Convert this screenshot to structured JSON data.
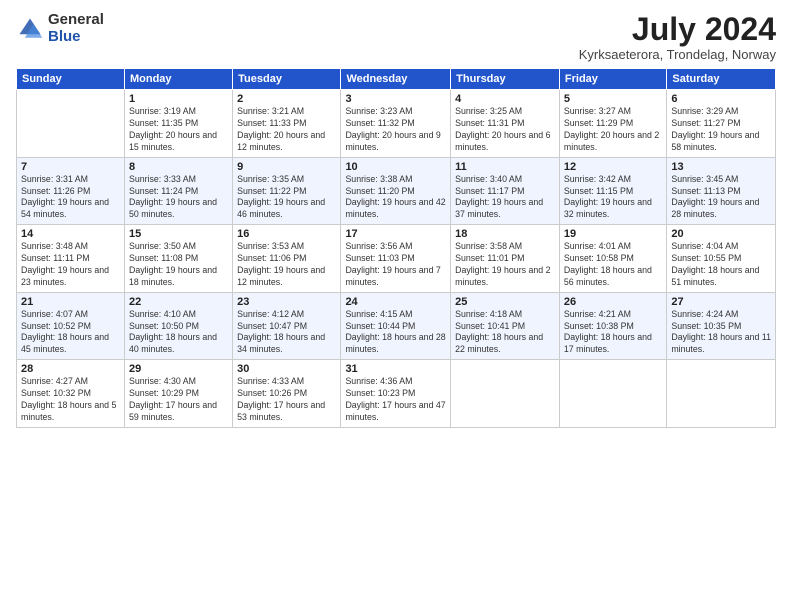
{
  "logo": {
    "general": "General",
    "blue": "Blue"
  },
  "title": "July 2024",
  "location": "Kyrksaeterora, Trondelag, Norway",
  "weekdays": [
    "Sunday",
    "Monday",
    "Tuesday",
    "Wednesday",
    "Thursday",
    "Friday",
    "Saturday"
  ],
  "weeks": [
    [
      {
        "day": "",
        "sunrise": "",
        "sunset": "",
        "daylight": ""
      },
      {
        "day": "1",
        "sunrise": "Sunrise: 3:19 AM",
        "sunset": "Sunset: 11:35 PM",
        "daylight": "Daylight: 20 hours and 15 minutes."
      },
      {
        "day": "2",
        "sunrise": "Sunrise: 3:21 AM",
        "sunset": "Sunset: 11:33 PM",
        "daylight": "Daylight: 20 hours and 12 minutes."
      },
      {
        "day": "3",
        "sunrise": "Sunrise: 3:23 AM",
        "sunset": "Sunset: 11:32 PM",
        "daylight": "Daylight: 20 hours and 9 minutes."
      },
      {
        "day": "4",
        "sunrise": "Sunrise: 3:25 AM",
        "sunset": "Sunset: 11:31 PM",
        "daylight": "Daylight: 20 hours and 6 minutes."
      },
      {
        "day": "5",
        "sunrise": "Sunrise: 3:27 AM",
        "sunset": "Sunset: 11:29 PM",
        "daylight": "Daylight: 20 hours and 2 minutes."
      },
      {
        "day": "6",
        "sunrise": "Sunrise: 3:29 AM",
        "sunset": "Sunset: 11:27 PM",
        "daylight": "Daylight: 19 hours and 58 minutes."
      }
    ],
    [
      {
        "day": "7",
        "sunrise": "Sunrise: 3:31 AM",
        "sunset": "Sunset: 11:26 PM",
        "daylight": "Daylight: 19 hours and 54 minutes."
      },
      {
        "day": "8",
        "sunrise": "Sunrise: 3:33 AM",
        "sunset": "Sunset: 11:24 PM",
        "daylight": "Daylight: 19 hours and 50 minutes."
      },
      {
        "day": "9",
        "sunrise": "Sunrise: 3:35 AM",
        "sunset": "Sunset: 11:22 PM",
        "daylight": "Daylight: 19 hours and 46 minutes."
      },
      {
        "day": "10",
        "sunrise": "Sunrise: 3:38 AM",
        "sunset": "Sunset: 11:20 PM",
        "daylight": "Daylight: 19 hours and 42 minutes."
      },
      {
        "day": "11",
        "sunrise": "Sunrise: 3:40 AM",
        "sunset": "Sunset: 11:17 PM",
        "daylight": "Daylight: 19 hours and 37 minutes."
      },
      {
        "day": "12",
        "sunrise": "Sunrise: 3:42 AM",
        "sunset": "Sunset: 11:15 PM",
        "daylight": "Daylight: 19 hours and 32 minutes."
      },
      {
        "day": "13",
        "sunrise": "Sunrise: 3:45 AM",
        "sunset": "Sunset: 11:13 PM",
        "daylight": "Daylight: 19 hours and 28 minutes."
      }
    ],
    [
      {
        "day": "14",
        "sunrise": "Sunrise: 3:48 AM",
        "sunset": "Sunset: 11:11 PM",
        "daylight": "Daylight: 19 hours and 23 minutes."
      },
      {
        "day": "15",
        "sunrise": "Sunrise: 3:50 AM",
        "sunset": "Sunset: 11:08 PM",
        "daylight": "Daylight: 19 hours and 18 minutes."
      },
      {
        "day": "16",
        "sunrise": "Sunrise: 3:53 AM",
        "sunset": "Sunset: 11:06 PM",
        "daylight": "Daylight: 19 hours and 12 minutes."
      },
      {
        "day": "17",
        "sunrise": "Sunrise: 3:56 AM",
        "sunset": "Sunset: 11:03 PM",
        "daylight": "Daylight: 19 hours and 7 minutes."
      },
      {
        "day": "18",
        "sunrise": "Sunrise: 3:58 AM",
        "sunset": "Sunset: 11:01 PM",
        "daylight": "Daylight: 19 hours and 2 minutes."
      },
      {
        "day": "19",
        "sunrise": "Sunrise: 4:01 AM",
        "sunset": "Sunset: 10:58 PM",
        "daylight": "Daylight: 18 hours and 56 minutes."
      },
      {
        "day": "20",
        "sunrise": "Sunrise: 4:04 AM",
        "sunset": "Sunset: 10:55 PM",
        "daylight": "Daylight: 18 hours and 51 minutes."
      }
    ],
    [
      {
        "day": "21",
        "sunrise": "Sunrise: 4:07 AM",
        "sunset": "Sunset: 10:52 PM",
        "daylight": "Daylight: 18 hours and 45 minutes."
      },
      {
        "day": "22",
        "sunrise": "Sunrise: 4:10 AM",
        "sunset": "Sunset: 10:50 PM",
        "daylight": "Daylight: 18 hours and 40 minutes."
      },
      {
        "day": "23",
        "sunrise": "Sunrise: 4:12 AM",
        "sunset": "Sunset: 10:47 PM",
        "daylight": "Daylight: 18 hours and 34 minutes."
      },
      {
        "day": "24",
        "sunrise": "Sunrise: 4:15 AM",
        "sunset": "Sunset: 10:44 PM",
        "daylight": "Daylight: 18 hours and 28 minutes."
      },
      {
        "day": "25",
        "sunrise": "Sunrise: 4:18 AM",
        "sunset": "Sunset: 10:41 PM",
        "daylight": "Daylight: 18 hours and 22 minutes."
      },
      {
        "day": "26",
        "sunrise": "Sunrise: 4:21 AM",
        "sunset": "Sunset: 10:38 PM",
        "daylight": "Daylight: 18 hours and 17 minutes."
      },
      {
        "day": "27",
        "sunrise": "Sunrise: 4:24 AM",
        "sunset": "Sunset: 10:35 PM",
        "daylight": "Daylight: 18 hours and 11 minutes."
      }
    ],
    [
      {
        "day": "28",
        "sunrise": "Sunrise: 4:27 AM",
        "sunset": "Sunset: 10:32 PM",
        "daylight": "Daylight: 18 hours and 5 minutes."
      },
      {
        "day": "29",
        "sunrise": "Sunrise: 4:30 AM",
        "sunset": "Sunset: 10:29 PM",
        "daylight": "Daylight: 17 hours and 59 minutes."
      },
      {
        "day": "30",
        "sunrise": "Sunrise: 4:33 AM",
        "sunset": "Sunset: 10:26 PM",
        "daylight": "Daylight: 17 hours and 53 minutes."
      },
      {
        "day": "31",
        "sunrise": "Sunrise: 4:36 AM",
        "sunset": "Sunset: 10:23 PM",
        "daylight": "Daylight: 17 hours and 47 minutes."
      },
      {
        "day": "",
        "sunrise": "",
        "sunset": "",
        "daylight": ""
      },
      {
        "day": "",
        "sunrise": "",
        "sunset": "",
        "daylight": ""
      },
      {
        "day": "",
        "sunrise": "",
        "sunset": "",
        "daylight": ""
      }
    ]
  ]
}
